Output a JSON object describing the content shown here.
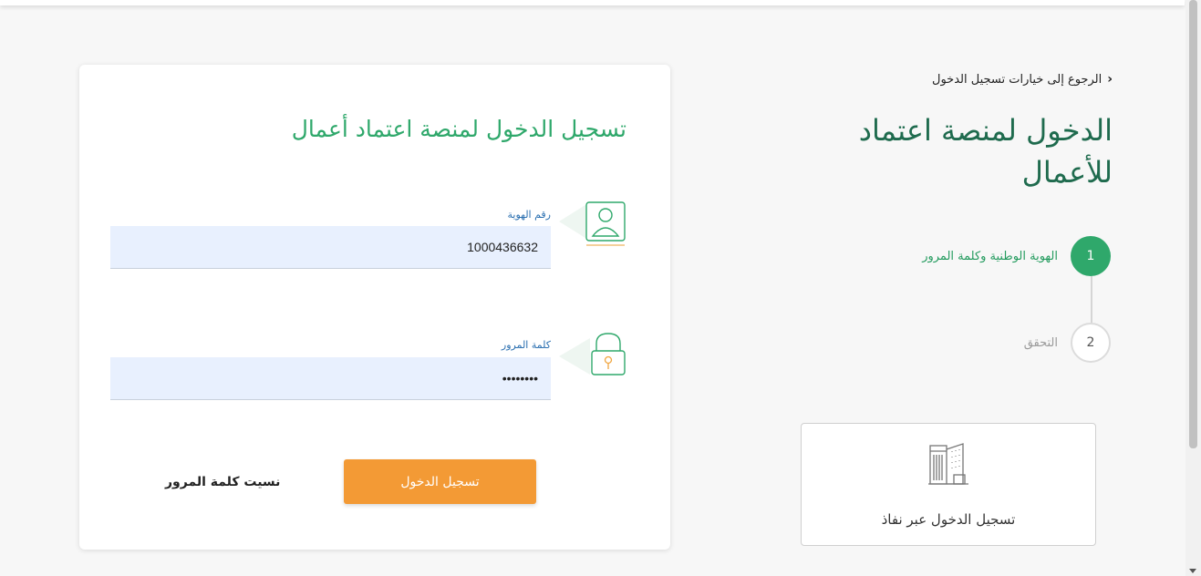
{
  "back_link": {
    "label": "الرجوع إلى خيارات تسجيل الدخول"
  },
  "side": {
    "title": "الدخول لمنصة اعتماد للأعمال",
    "steps": [
      {
        "number": "1",
        "label": "الهوية الوطنية وكلمة المرور",
        "active": true
      },
      {
        "number": "2",
        "label": "التحقق",
        "active": false
      }
    ],
    "nafath": {
      "label": "تسجيل الدخول عبر نفاذ",
      "icon": "building-icon"
    }
  },
  "login": {
    "title": "تسجيل الدخول لمنصة اعتماد أعمال",
    "id_field": {
      "label": "رقم الهوية",
      "value": "1000436632",
      "icon": "user-icon"
    },
    "password_field": {
      "label": "كلمة المرور",
      "value": "••••••••",
      "icon": "lock-icon"
    },
    "submit_label": "تسجيل الدخول",
    "forgot_label": "نسيت كلمة المرور"
  },
  "colors": {
    "primary_green": "#2fa86b",
    "title_green": "#1f6b4e",
    "accent_orange": "#f39a35",
    "link_blue": "#2a6fb0"
  }
}
